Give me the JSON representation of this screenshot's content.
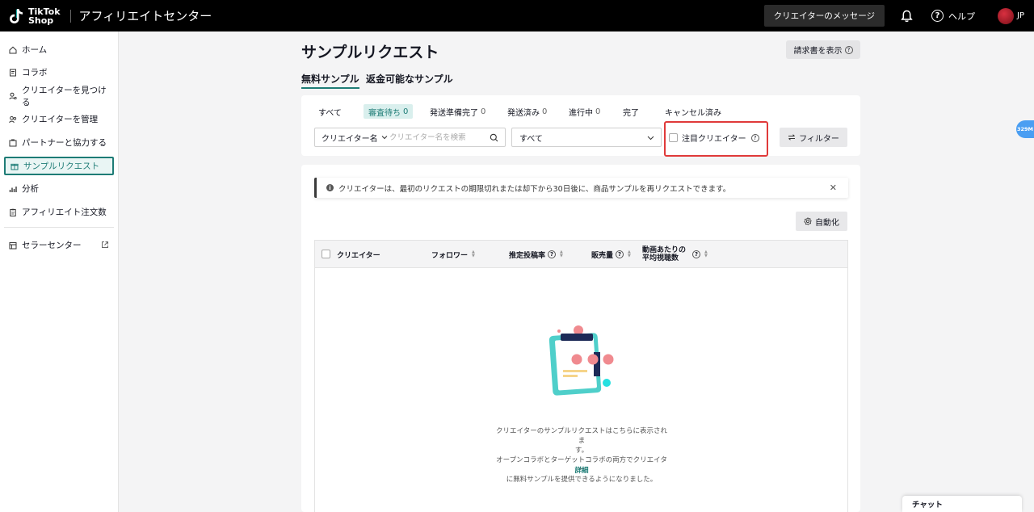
{
  "topbar": {
    "logo_line1": "TikTok",
    "logo_line2": "Shop",
    "app_title": "アフィリエイトセンター",
    "messages_label": "クリエイターのメッセージ",
    "help_label": "ヘルプ",
    "lang_label": "JP"
  },
  "sidebar": {
    "items": [
      {
        "label": "ホーム",
        "icon": "home-icon"
      },
      {
        "label": "コラボ",
        "icon": "collab-icon"
      },
      {
        "label": "クリエイターを見つける",
        "icon": "find-creator-icon"
      },
      {
        "label": "クリエイターを管理",
        "icon": "manage-creator-icon"
      },
      {
        "label": "パートナーと協力する",
        "icon": "partner-icon"
      },
      {
        "label": "サンプルリクエスト",
        "icon": "gift-icon",
        "active": true
      },
      {
        "label": "分析",
        "icon": "chart-icon"
      },
      {
        "label": "アフィリエイト注文数",
        "icon": "clipboard-icon"
      }
    ],
    "seller_center": "セラーセンター"
  },
  "page": {
    "title": "サンプルリクエスト",
    "invoice_button": "請求書を表示",
    "tabs": [
      "無料サンプル",
      "返金可能なサンプル"
    ]
  },
  "status_tabs": [
    {
      "label": "すべて",
      "count": ""
    },
    {
      "label": "審査待ち",
      "count": "0"
    },
    {
      "label": "発送準備完了",
      "count": "0"
    },
    {
      "label": "発送済み",
      "count": "0"
    },
    {
      "label": "進行中",
      "count": "0"
    },
    {
      "label": "完了",
      "count": ""
    },
    {
      "label": "キャンセル済み",
      "count": ""
    }
  ],
  "filters": {
    "search_type": "クリエイター名",
    "search_placeholder": "クリエイター名を検索",
    "status_value": "すべて",
    "featured_label": "注目クリエイター",
    "filter_button": "フィルター"
  },
  "notice": {
    "text": "クリエイターは、最初のリクエストの期限切れまたは却下から30日後に、商品サンプルを再リクエストできます。"
  },
  "automation_button": "自動化",
  "table": {
    "columns": [
      "クリエイター",
      "フォロワー",
      "推定投稿率",
      "販売量",
      "動画あたりの",
      "平均視聴数"
    ]
  },
  "empty": {
    "line1": "クリエイターのサンプルリクエストはこちらに表示されま",
    "line2": "す。",
    "line3": "オープンコラボとターゲットコラボの両方でクリエイター",
    "line4": "に無料サンプルを提供できるようになりました。",
    "link": "詳細"
  },
  "side_badge": "329M",
  "chat_label": "チャット",
  "colors": {
    "accent": "#1e7c76",
    "highlight_border": "#e03a3a"
  }
}
